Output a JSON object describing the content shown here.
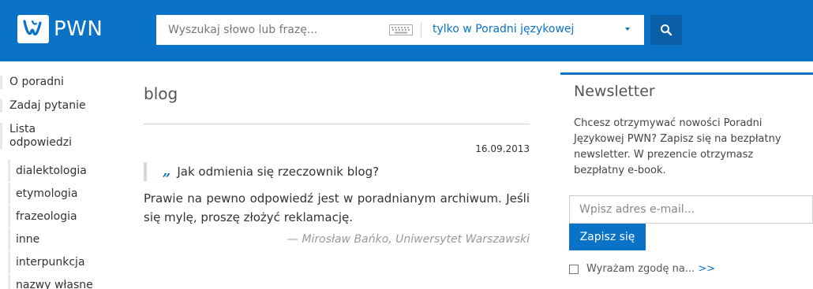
{
  "header": {
    "logo_text": "PWN",
    "search": {
      "placeholder": "Wyszukaj słowo lub frazę...",
      "scope": "tylko w Poradni językowej",
      "keyboard_icon": "keyboard-icon",
      "button_icon": "search-icon"
    }
  },
  "sidebar": {
    "items": [
      {
        "label": "O poradni"
      },
      {
        "label": "Zadaj pytanie"
      },
      {
        "label": "Lista odpowiedzi"
      }
    ],
    "subitems": [
      {
        "label": "dialektologia"
      },
      {
        "label": "etymologia"
      },
      {
        "label": "frazeologia"
      },
      {
        "label": "inne"
      },
      {
        "label": "interpunkcja"
      },
      {
        "label": "nazwy własne"
      }
    ]
  },
  "main": {
    "title": "blog",
    "date": "16.09.2013",
    "question": "Jak odmienia się rzeczownik blog?",
    "answer": "Prawie na pewno odpowiedź jest w poradnianym archiwum. Jeśli się mylę, proszę złożyć reklamację.",
    "author": "— Mirosław Bańko, Uniwersytet Warszawski"
  },
  "newsletter": {
    "title": "Newsletter",
    "text": "Chcesz otrzymywać nowości Poradni Językowej PWN? Zapisz się na bezpłatny newsletter. W prezencie otrzymasz bezpłatny e-book.",
    "email_placeholder": "Wpisz adres e-mail...",
    "button": "Zapisz się",
    "consent": "Wyrażam zgodę na...",
    "more": ">>"
  },
  "colors": {
    "brand": "#0a73c7",
    "search_button": "#0a5fa8"
  }
}
